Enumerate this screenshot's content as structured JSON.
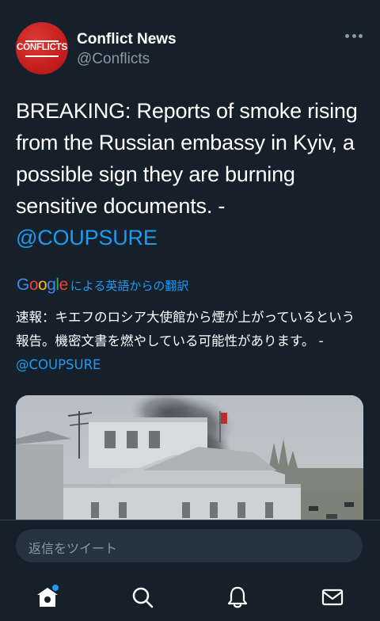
{
  "tweet": {
    "avatar_logo_text": "CONFLICTS",
    "display_name": "Conflict News",
    "handle": "@Conflicts",
    "text": "BREAKING: Reports of smoke rising from the Russian embassy in Kyiv, a possible sign they are burning sensitive documents. - ",
    "mention": "@COUPSURE",
    "translation": {
      "google_letters": [
        "G",
        "o",
        "o",
        "g",
        "l",
        "e"
      ],
      "label": "による英語からの翻訳",
      "text": "速報：キエフのロシア大使館から煙が上がっているという報告。機密文書を燃やしている可能性があります。 - ",
      "mention": "@COUPSURE"
    },
    "media": {
      "description": "photo-building-smoke"
    }
  },
  "reply": {
    "placeholder": "返信をツイート"
  },
  "nav": {
    "items": [
      {
        "name": "home",
        "icon": "home-icon",
        "active": true,
        "has_dot": true
      },
      {
        "name": "search",
        "icon": "search-icon",
        "active": false
      },
      {
        "name": "notifications",
        "icon": "bell-icon",
        "active": false
      },
      {
        "name": "messages",
        "icon": "mail-icon",
        "active": false
      }
    ]
  },
  "colors": {
    "background": "#15202b",
    "text": "#ffffff",
    "secondary_text": "#8899a6",
    "accent": "#1d9bf0",
    "avatar_red": "#c41e1e",
    "divider": "#38444d",
    "reply_box": "#253341"
  }
}
